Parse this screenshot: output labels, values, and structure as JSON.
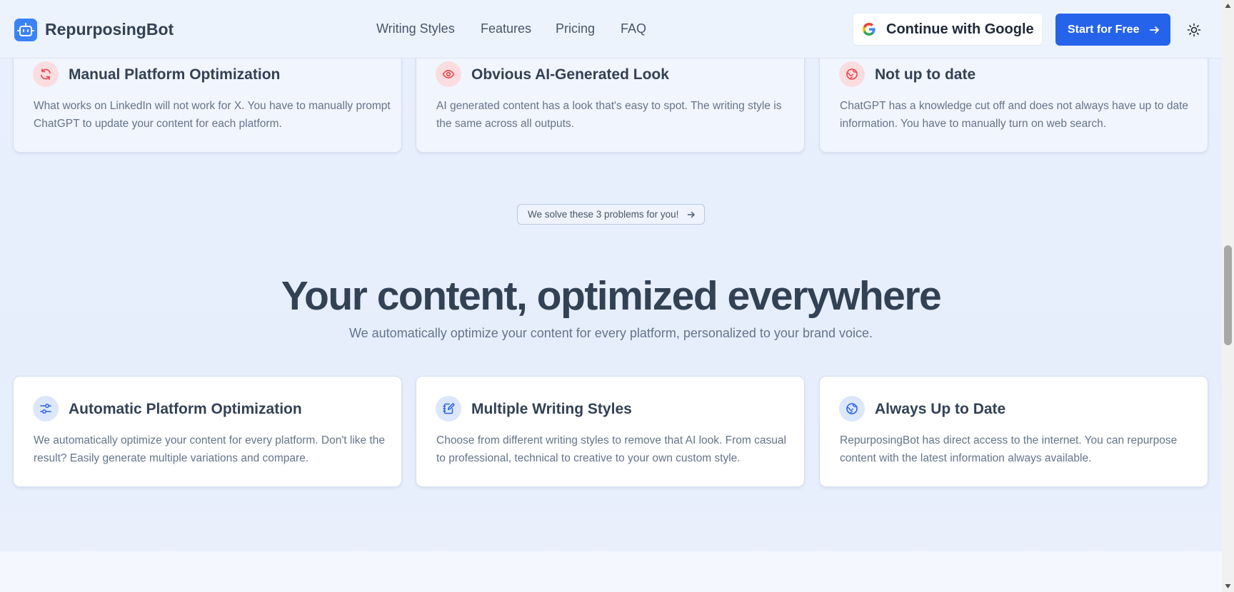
{
  "header": {
    "brand": "RepurposingBot",
    "nav": [
      "Writing Styles",
      "Features",
      "Pricing",
      "FAQ"
    ],
    "google_label": "Continue with Google",
    "start_label": "Start for Free"
  },
  "problems": [
    {
      "icon": "refresh-icon",
      "title": "Manual Platform Optimization",
      "desc": "What works on LinkedIn will not work for X. You have to manually prompt ChatGPT to update your content for each platform."
    },
    {
      "icon": "eye-icon",
      "title": "Obvious AI-Generated Look",
      "desc": "AI generated content has a look that's easy to spot. The writing style is the same across all outputs."
    },
    {
      "icon": "globe-icon",
      "title": "Not up to date",
      "desc": "ChatGPT has a knowledge cut off and does not always have up to date information. You have to manually turn on web search."
    }
  ],
  "solve_pill": "We solve these 3 problems for you!",
  "heading": "Your content, optimized everywhere",
  "subheading": "We automatically optimize your content for every platform, personalized to your brand voice.",
  "solutions": [
    {
      "icon": "sliders-icon",
      "title": "Automatic Platform Optimization",
      "desc": "We automatically optimize your content for every platform. Don't like the result? Easily generate multiple variations and compare."
    },
    {
      "icon": "notebook-pen-icon",
      "title": "Multiple Writing Styles",
      "desc": "Choose from different writing styles to remove that AI look. From casual to professional, technical to creative to your own custom style."
    },
    {
      "icon": "globe-icon",
      "title": "Always Up to Date",
      "desc": "RepurposingBot has direct access to the internet. You can repurpose content with the latest information always available."
    }
  ],
  "colors": {
    "accent": "#2563eb",
    "problem_icon": "#ef4444",
    "solution_icon": "#2563eb"
  }
}
